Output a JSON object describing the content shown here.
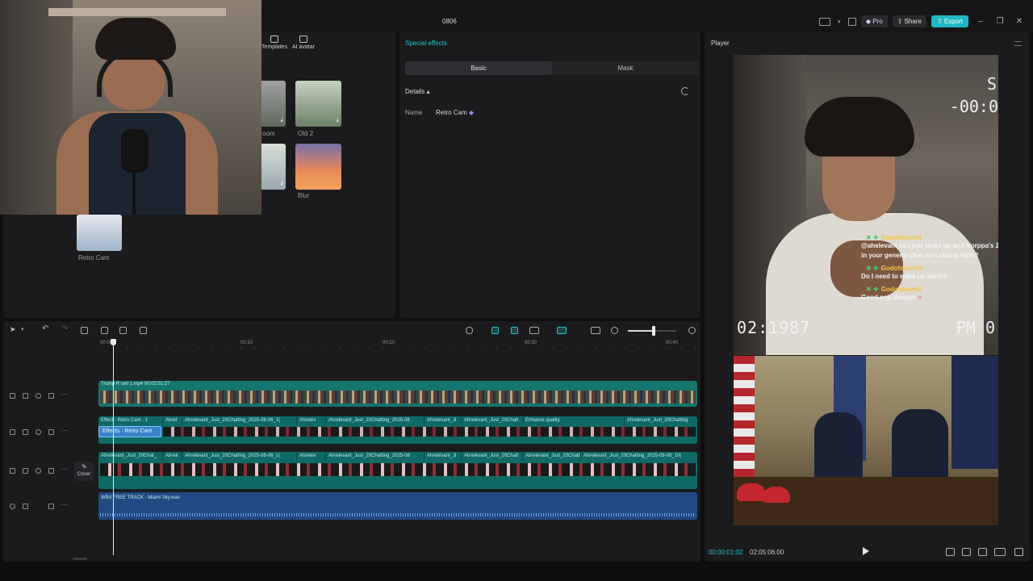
{
  "window": {
    "title": "0806",
    "pro_label": "Pro",
    "share_label": "Share",
    "export_label": "Export"
  },
  "media_panel": {
    "tabs": [
      {
        "label": "Templates",
        "icon": "templates-icon"
      },
      {
        "label": "AI avatar",
        "icon": "ai-avatar-icon"
      }
    ],
    "effects": [
      {
        "label": "oom"
      },
      {
        "label": "Old 2"
      },
      {
        "label": "Blur"
      },
      {
        "label": "Retro Cam"
      }
    ]
  },
  "fx_panel": {
    "title": "Special effects",
    "tabs": [
      "Basic",
      "Mask"
    ],
    "details_label": "Details ▴",
    "name_label": "Name",
    "name_value": "Retro Cam"
  },
  "player": {
    "title": "Player",
    "current_time": "00:00:01:02",
    "total_time": "02:05:06:00",
    "vhs_date": "02:1987",
    "vhs_ampm": "PM 0",
    "vhs_counter": "-00:0",
    "vhs_s": "S",
    "chat": [
      {
        "user": "Godofdoors0",
        "text": "@ahelevant ok I just woke up and Norppa's 2nd to last comment in your general chat isn't stupid right?"
      },
      {
        "user": "Godofdoors0",
        "text": "Do I need to wake up more?"
      },
      {
        "user": "Godofdoors0",
        "text": "Good nap though"
      }
    ]
  },
  "timeline": {
    "ruler": [
      {
        "label": "00:00"
      },
      {
        "label": "00:10"
      },
      {
        "label": "00:20"
      },
      {
        "label": "00:30"
      },
      {
        "label": "00:40"
      }
    ],
    "video_clip_label": "Trump R sell 1.mp4   00:02:51:27",
    "fx_chip_label": "Effects · Retro Cam",
    "fx_subclips": [
      "Effect · Retro Cam · 1",
      "Ahrel",
      "Ahrelevant_Just_20Chatting_2025-08-06_1(",
      "Ahrelev",
      "Ahrelevant_Just_20Chatting_2025-08",
      "Ahrelevant_Ji",
      "Ahrelevant_Just_20Chatt",
      "Enhance quality",
      "Ahrelevant_Just_20Chatting"
    ],
    "chat_subclips": [
      "Ahrelevant_Just_20Chat_",
      "Ahrek",
      "Ahrelevant_Just_20Chatting_2025-08-06_1(",
      "Ahrelev",
      "Ahrelevant_Just_20Chatting_2025-08",
      "Ahrelevant_Ji",
      "Ahrelevant_Just_20Chatt",
      "Ahrelevant_Just_20Chatting_2025-08",
      "Ahrelevant_Just_20Chatting_2025-08-06_10("
    ],
    "audio_label": "WBA FREE TRACK - Miami Sky.wav",
    "cover_label": "Cover"
  }
}
